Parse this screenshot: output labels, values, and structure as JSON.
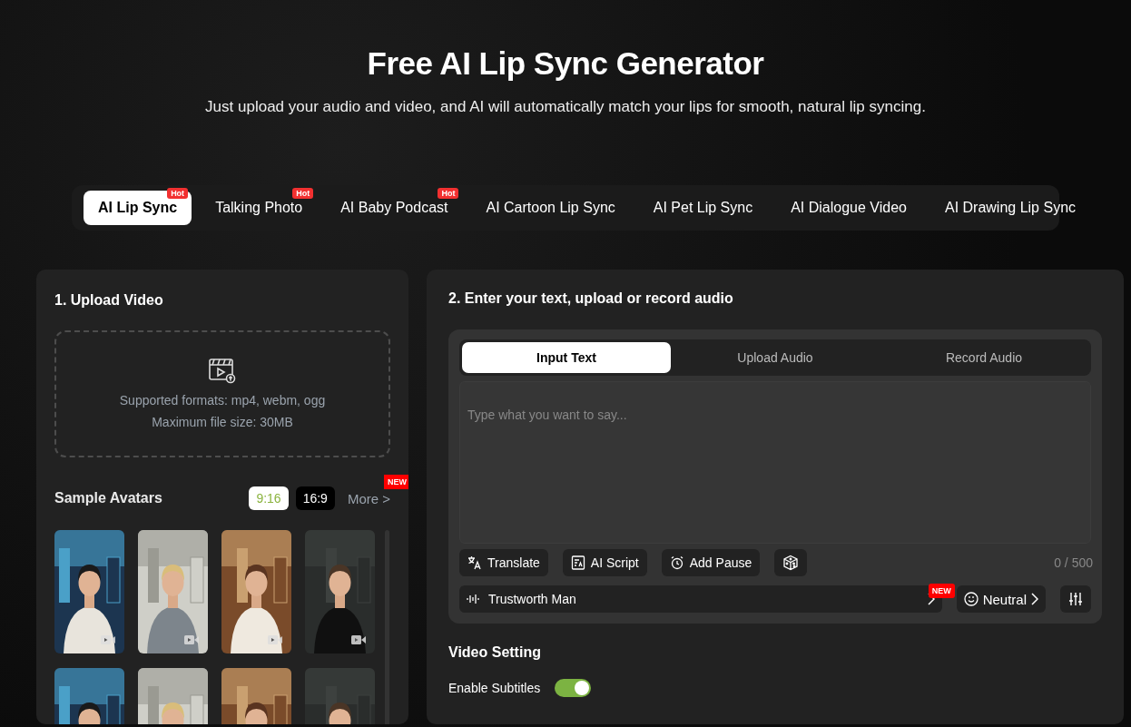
{
  "header": {
    "title": "Free AI Lip Sync Generator",
    "subtitle": "Just upload your audio and video, and AI will automatically match your lips for smooth, natural lip syncing."
  },
  "tabs": [
    {
      "label": "AI Lip Sync",
      "selected": true,
      "badge": "Hot"
    },
    {
      "label": "Talking Photo",
      "selected": false,
      "badge": "Hot"
    },
    {
      "label": "AI Baby Podcast",
      "selected": false,
      "badge": "Hot"
    },
    {
      "label": "AI Cartoon Lip Sync",
      "selected": false
    },
    {
      "label": "AI Pet Lip Sync",
      "selected": false
    },
    {
      "label": "AI Dialogue Video",
      "selected": false
    },
    {
      "label": "AI Drawing Lip Sync",
      "selected": false
    }
  ],
  "upload_panel": {
    "heading": "1. Upload Video",
    "formats": "Supported formats: mp4, webm, ogg",
    "max_size": "Maximum file size: 30MB",
    "sample_avatars": {
      "heading": "Sample Avatars",
      "ratios": [
        {
          "label": "9:16",
          "selected": true
        },
        {
          "label": "16:9",
          "selected": false
        }
      ],
      "more": "More >",
      "more_badge": "NEW"
    }
  },
  "audio_panel": {
    "heading": "2. Enter your text, upload or record audio",
    "input_tabs": [
      {
        "label": "Input Text",
        "selected": true
      },
      {
        "label": "Upload Audio",
        "selected": false
      },
      {
        "label": "Record Audio",
        "selected": false
      }
    ],
    "text_field": {
      "placeholder": "Type what you want to say..."
    },
    "tools": [
      {
        "kind": "translate",
        "label": "Translate"
      },
      {
        "kind": "script",
        "label": "AI Script"
      },
      {
        "kind": "pause",
        "label": "Add Pause"
      },
      {
        "kind": "random"
      }
    ],
    "counter": "0 / 500",
    "voice": {
      "name": "Trustworth Man",
      "badge": "NEW"
    },
    "emotion": "Neutral"
  },
  "video_setting": {
    "heading": "Video Setting",
    "subtitles": {
      "label": "Enable Subtitles",
      "on": true
    }
  }
}
